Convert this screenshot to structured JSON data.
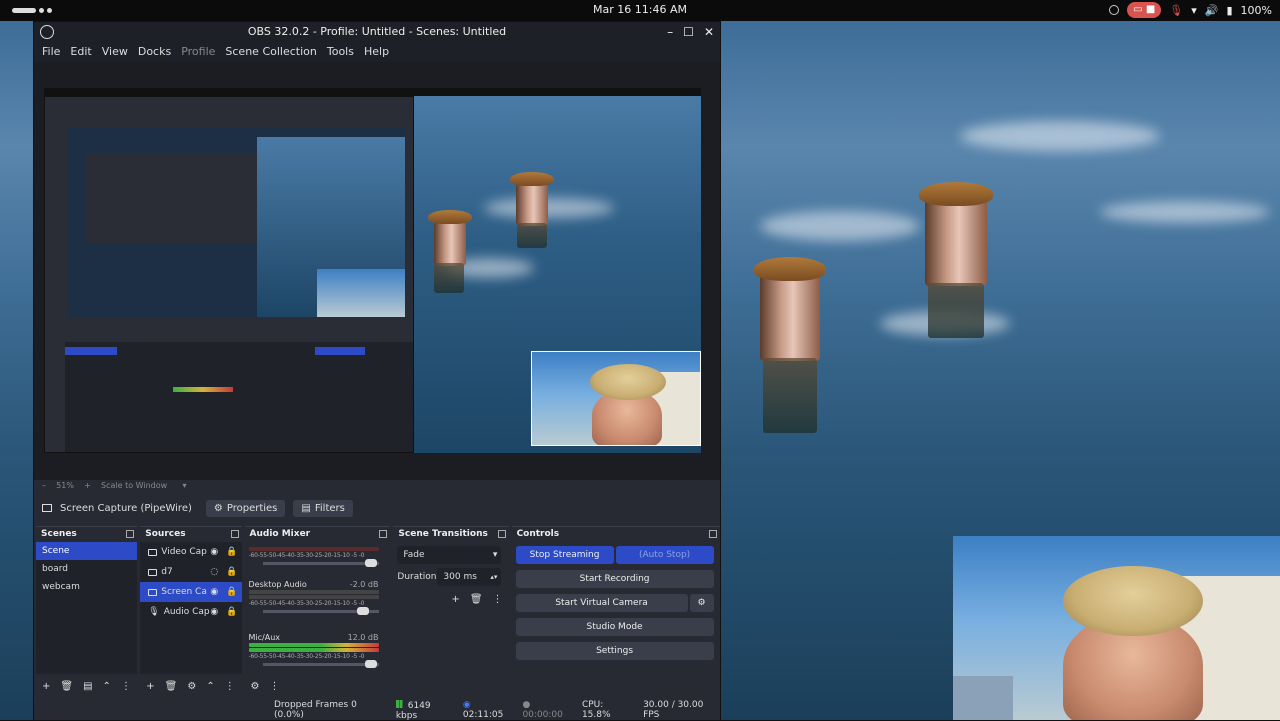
{
  "topbar": {
    "clock": "Mar 16  11:46 AM",
    "battery": "100%"
  },
  "window": {
    "title": "OBS 32.0.2 - Profile: Untitled - Scenes: Untitled"
  },
  "menu": [
    "File",
    "Edit",
    "View",
    "Docks",
    "Profile",
    "Scene Collection",
    "Tools",
    "Help"
  ],
  "preview": {
    "zoom": "51%",
    "scale_mode": "Scale to Window"
  },
  "source_bar": {
    "source_name": "Screen Capture (PipeWire)",
    "properties": "Properties",
    "filters": "Filters"
  },
  "scenes": {
    "title": "Scenes",
    "items": [
      "Scene",
      "board",
      "webcam"
    ],
    "selected": 0
  },
  "sources": {
    "title": "Sources",
    "items": [
      "Video Cap",
      "d7",
      "Screen Ca",
      "Audio Cap"
    ],
    "selected": 2
  },
  "mixer": {
    "title": "Audio Mixer",
    "scale": "-60-55-50-45-40-35-30-25-20-15-10 -5 -0",
    "channels": [
      {
        "name": "",
        "db": ""
      },
      {
        "name": "Desktop Audio",
        "db": "-2.0 dB"
      },
      {
        "name": "Mic/Aux",
        "db": "12.0 dB"
      }
    ]
  },
  "transitions": {
    "title": "Scene Transitions",
    "type": "Fade",
    "duration_label": "Duration",
    "duration": "300 ms"
  },
  "controls": {
    "title": "Controls",
    "stop_streaming": "Stop Streaming",
    "auto_stop": "(Auto Stop)",
    "start_recording": "Start Recording",
    "start_virtual_camera": "Start Virtual Camera",
    "studio_mode": "Studio Mode",
    "settings": "Settings"
  },
  "status": {
    "dropped_frames": "Dropped Frames 0 (0.0%)",
    "bitrate": "6149 kbps",
    "stream_time": "02:11:05",
    "record_time": "00:00:00",
    "cpu": "CPU: 15.8%",
    "fps": "30.00 / 30.00 FPS"
  }
}
